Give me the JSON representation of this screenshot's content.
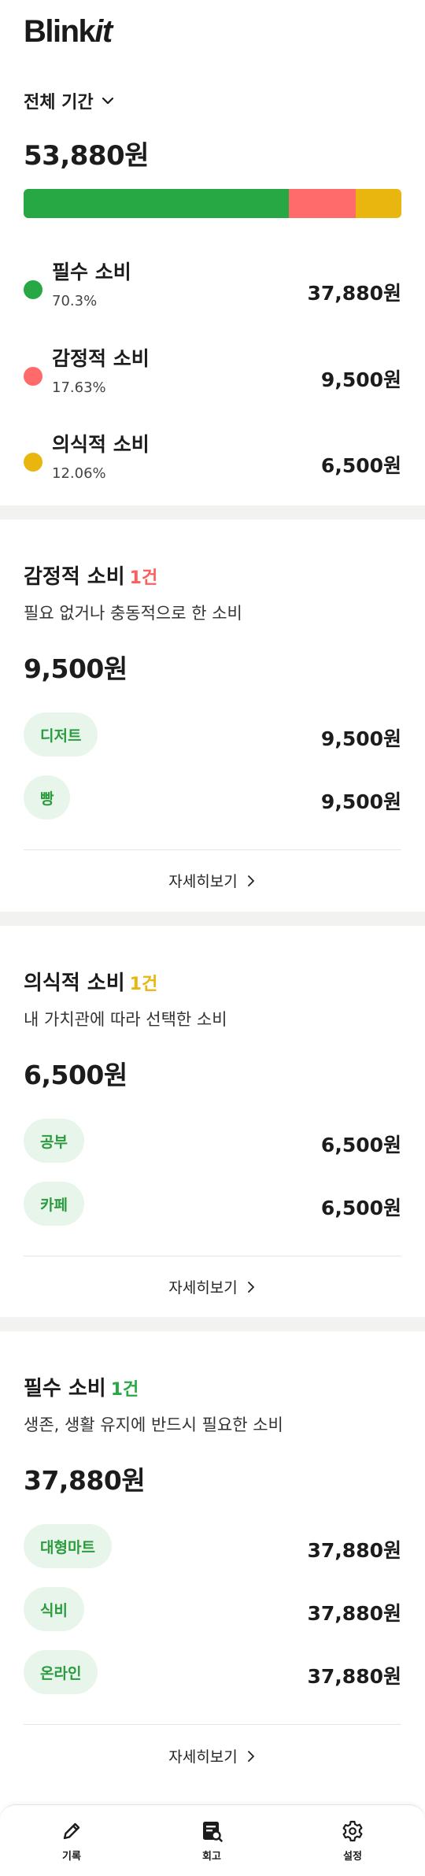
{
  "app": {
    "logo_main": "Blink",
    "logo_italic": "it"
  },
  "summary": {
    "period_label": "전체 기간",
    "total": "53,880원",
    "bar": [
      {
        "name": "필수 소비",
        "fraction": 0.703,
        "color": "#27a844"
      },
      {
        "name": "감정적 소비",
        "fraction": 0.1763,
        "color": "#ff6b6b"
      },
      {
        "name": "의식적 소비",
        "fraction": 0.1206,
        "color": "#e8b60e"
      }
    ],
    "legend": [
      {
        "name": "필수 소비",
        "percent": "70.3%",
        "amount": "37,880원",
        "color": "#27a844"
      },
      {
        "name": "감정적 소비",
        "percent": "17.63%",
        "amount": "9,500원",
        "color": "#ff6b6b"
      },
      {
        "name": "의식적 소비",
        "percent": "12.06%",
        "amount": "6,500원",
        "color": "#e8b60e"
      }
    ]
  },
  "sections": [
    {
      "title": "감정적 소비",
      "count": "1건",
      "count_color": "#ff5c5c",
      "description": "필요 없거나 충동적으로 한 소비",
      "total": "9,500원",
      "categories": [
        {
          "label": "디저트",
          "amount": "9,500원"
        },
        {
          "label": "빵",
          "amount": "9,500원"
        }
      ],
      "more_label": "자세히보기"
    },
    {
      "title": "의식적 소비",
      "count": "1건",
      "count_color": "#e8b60e",
      "description": "내 가치관에 따라 선택한 소비",
      "total": "6,500원",
      "categories": [
        {
          "label": "공부",
          "amount": "6,500원"
        },
        {
          "label": "카페",
          "amount": "6,500원"
        }
      ],
      "more_label": "자세히보기"
    },
    {
      "title": "필수 소비",
      "count": "1건",
      "count_color": "#27a844",
      "description": "생존, 생활 유지에 반드시 필요한 소비",
      "total": "37,880원",
      "categories": [
        {
          "label": "대형마트",
          "amount": "37,880원"
        },
        {
          "label": "식비",
          "amount": "37,880원"
        },
        {
          "label": "온라인",
          "amount": "37,880원"
        }
      ],
      "more_label": "자세히보기"
    }
  ],
  "nav": [
    {
      "label": "기록",
      "icon": "pencil-icon"
    },
    {
      "label": "회고",
      "icon": "review-icon"
    },
    {
      "label": "설정",
      "icon": "gear-icon"
    }
  ]
}
